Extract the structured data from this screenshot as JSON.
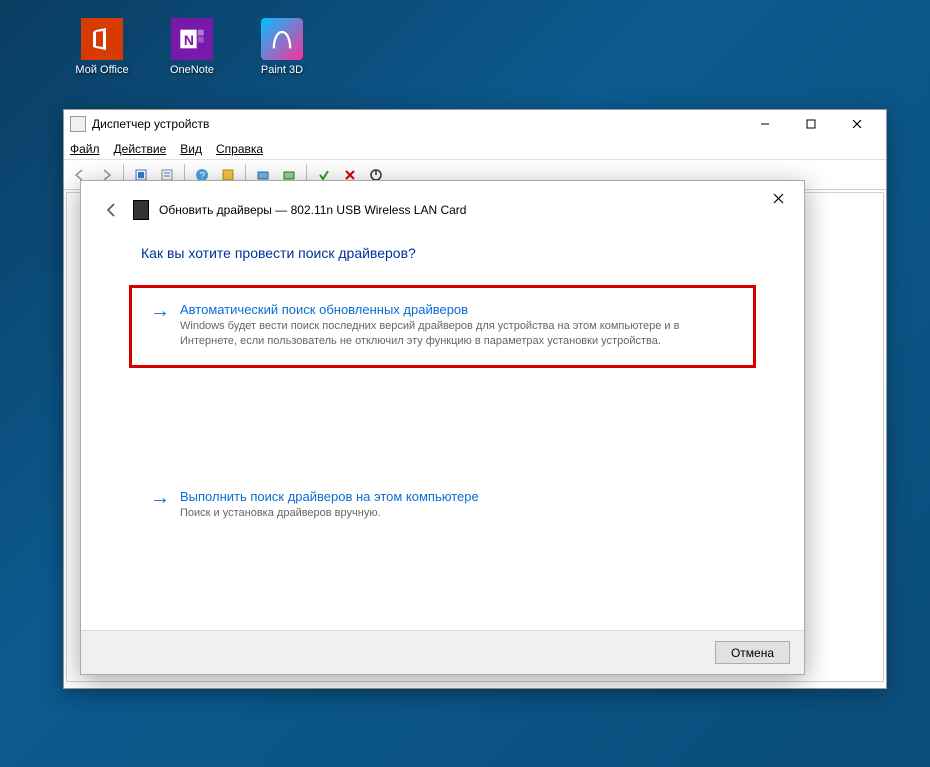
{
  "desktop": {
    "icons": [
      {
        "label": "Мой Office",
        "glyph": "O"
      },
      {
        "label": "OneNote",
        "glyph": "N"
      },
      {
        "label": "Paint 3D",
        "glyph": ""
      }
    ]
  },
  "device_manager": {
    "title": "Диспетчер устройств",
    "menu": {
      "file": "Файл",
      "action": "Действие",
      "view": "Вид",
      "help": "Справка"
    },
    "toolbar_icons": [
      "back-icon",
      "forward-icon",
      "show-hidden-icon",
      "properties-icon",
      "help-icon",
      "help2-icon",
      "scan-hardware-icon",
      "enable-icon",
      "disable-icon",
      "uninstall-icon"
    ]
  },
  "wizard": {
    "title_prefix": "Обновить драйверы — ",
    "device_name": "802.11n USB Wireless LAN Card",
    "question": "Как вы хотите провести поиск драйверов?",
    "option_auto": {
      "title": "Автоматический поиск обновленных драйверов",
      "desc": "Windows будет вести поиск последних версий драйверов для устройства на этом компьютере и в Интернете, если пользователь не отключил эту функцию в параметрах установки устройства."
    },
    "option_manual": {
      "title": "Выполнить поиск драйверов на этом компьютере",
      "desc": "Поиск и установка драйверов вручную."
    },
    "cancel": "Отмена"
  }
}
